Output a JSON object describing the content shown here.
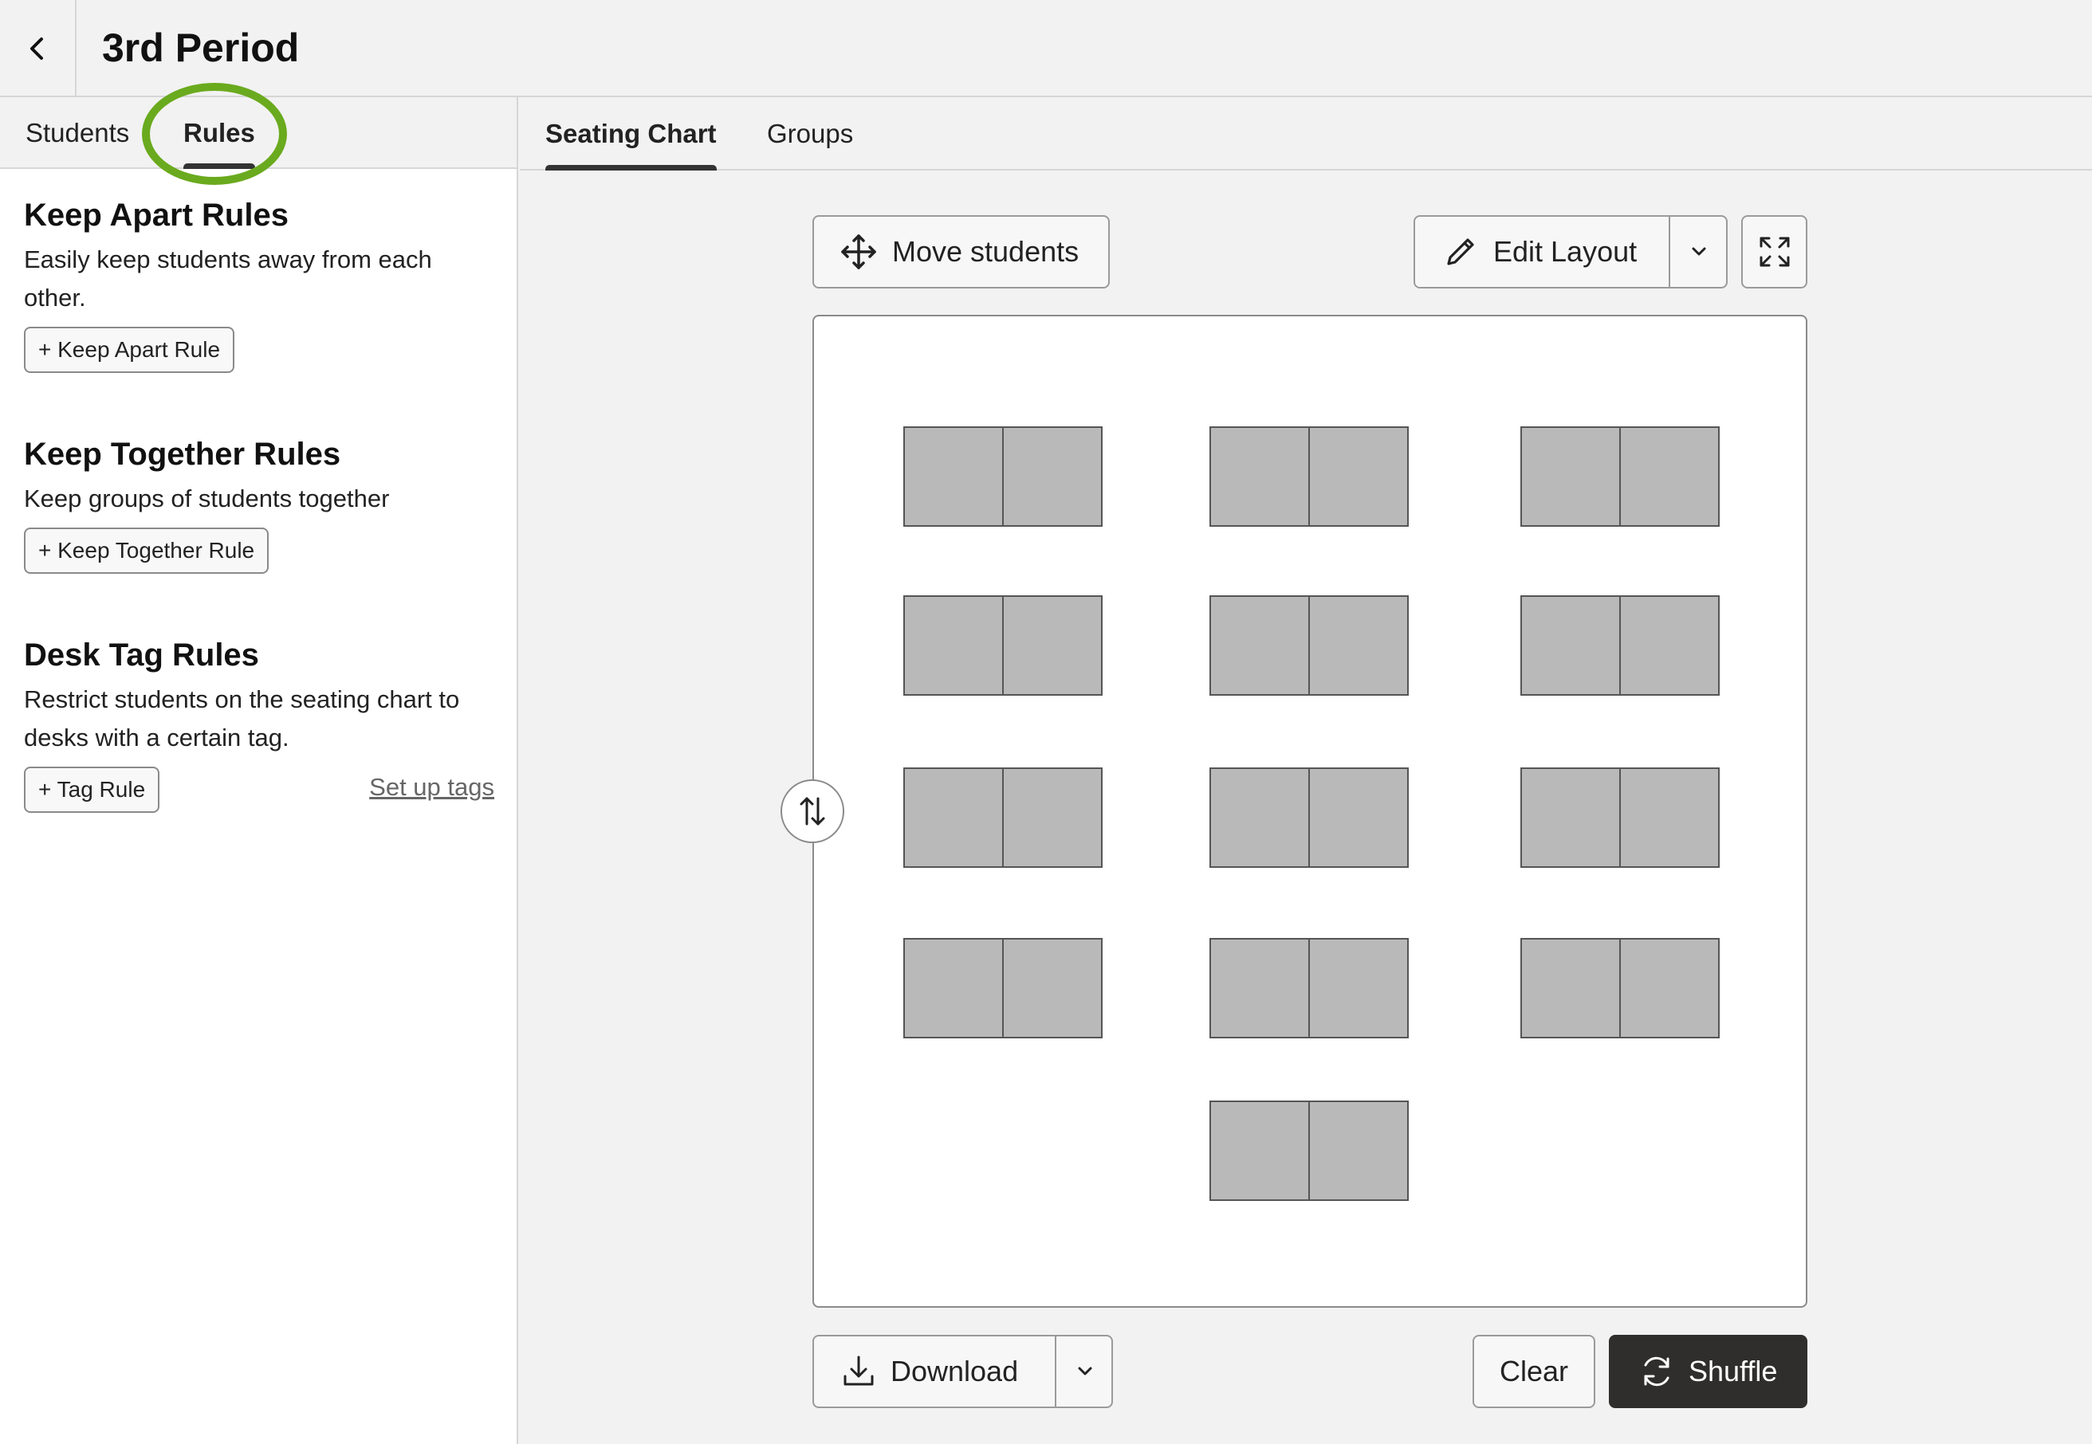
{
  "header": {
    "title": "3rd Period"
  },
  "left_tabs": [
    {
      "label": "Students",
      "active": false
    },
    {
      "label": "Rules",
      "active": true
    }
  ],
  "rules": {
    "keep_apart": {
      "title": "Keep Apart Rules",
      "description": "Easily keep students away from each other.",
      "button": "+ Keep Apart Rule"
    },
    "keep_together": {
      "title": "Keep Together Rules",
      "description": "Keep groups of students together",
      "button": "+ Keep Together Rule"
    },
    "desk_tag": {
      "title": "Desk Tag Rules",
      "description": "Restrict students on the seating chart to desks with a certain tag.",
      "button": "+ Tag Rule",
      "link": "Set up tags"
    }
  },
  "right_tabs": [
    {
      "label": "Seating Chart",
      "active": true
    },
    {
      "label": "Groups",
      "active": false
    }
  ],
  "toolbar": {
    "move_students": "Move students",
    "edit_layout": "Edit Layout"
  },
  "footer": {
    "download": "Download",
    "clear": "Clear",
    "shuffle": "Shuffle"
  },
  "seating": {
    "desk_count": 13,
    "seats_per_desk": 2,
    "rows": [
      3,
      3,
      3,
      3,
      1
    ]
  },
  "colors": {
    "accent_ring": "#6aaa1e",
    "desk_fill": "#b9b9b9",
    "shuffle_bg": "#2f2e2c"
  }
}
